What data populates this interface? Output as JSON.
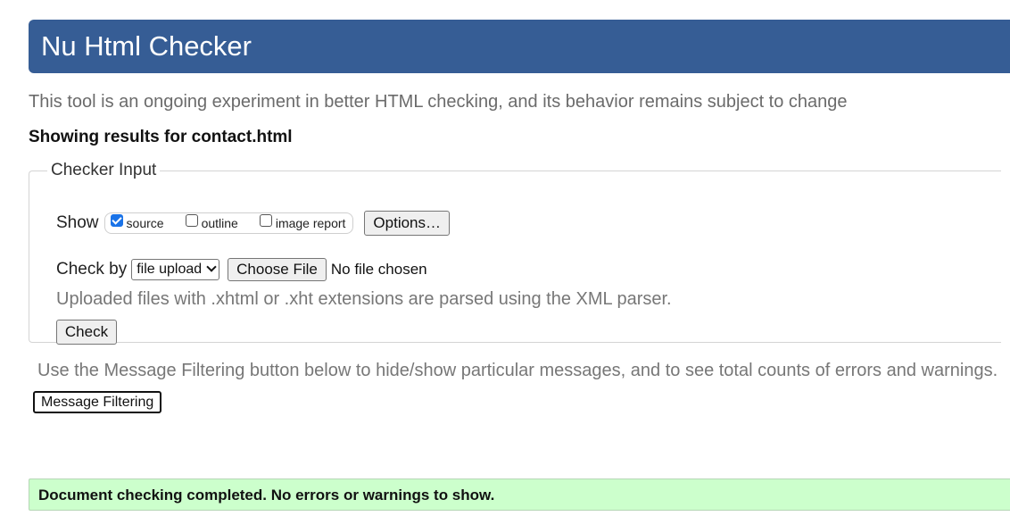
{
  "header": {
    "title": "Nu Html Checker",
    "background_color": "#365d95"
  },
  "intro": "This tool is an ongoing experiment in better HTML checking, and its behavior remains subject to change",
  "showing_results": "Showing results for contact.html",
  "checker_input": {
    "legend": "Checker Input",
    "show": {
      "label": "Show",
      "options": [
        {
          "label": "source",
          "checked": true
        },
        {
          "label": "outline",
          "checked": false
        },
        {
          "label": "image report",
          "checked": false
        }
      ],
      "options_button": "Options…"
    },
    "check_by": {
      "label": "Check by",
      "selected": "file upload",
      "choose_file_button": "Choose File",
      "file_status": "No file chosen"
    },
    "upload_note": "Uploaded files with .xhtml or .xht extensions are parsed using the XML parser.",
    "check_button": "Check"
  },
  "filtering": {
    "note": "Use the Message Filtering button below to hide/show particular messages, and to see total counts of errors and warnings.",
    "button": "Message Filtering"
  },
  "result": {
    "message": "Document checking completed. No errors or warnings to show.",
    "background_color": "#ccffcc"
  }
}
